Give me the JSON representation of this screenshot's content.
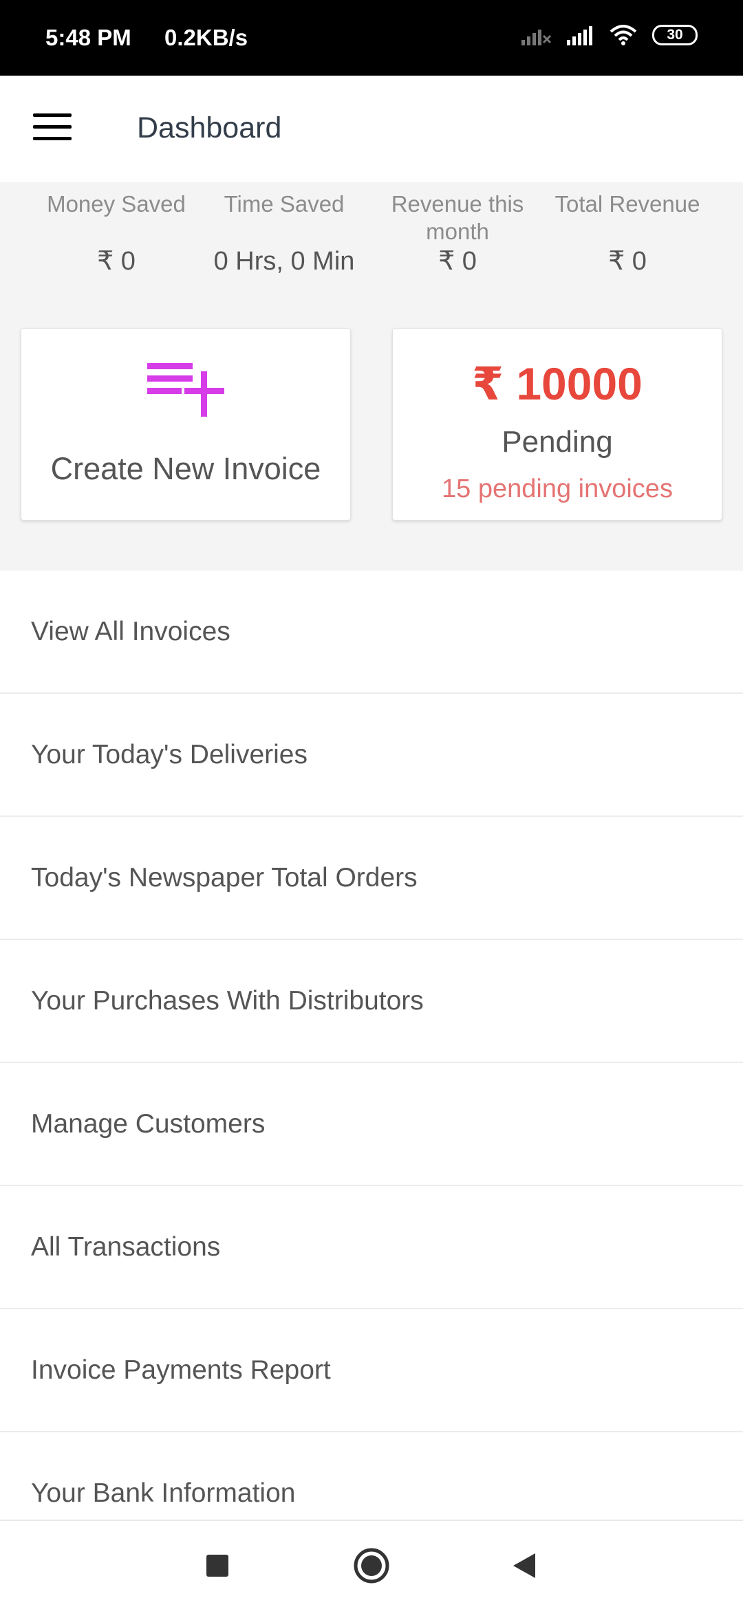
{
  "status_bar": {
    "time": "5:48 PM",
    "speed": "0.2KB/s",
    "battery": "30"
  },
  "app_bar": {
    "title": "Dashboard",
    "menu_icon": "hamburger-menu-icon"
  },
  "stats": [
    {
      "label": "Money Saved",
      "value": "₹ 0"
    },
    {
      "label": "Time Saved",
      "value": "0 Hrs, 0 Min"
    },
    {
      "label": "Revenue this month",
      "value": "₹ 0"
    },
    {
      "label": "Total Revenue",
      "value": "₹ 0"
    }
  ],
  "create_card": {
    "label": "Create New Invoice",
    "icon": "playlist-add-icon",
    "icon_color": "#d63ce8"
  },
  "pending_card": {
    "amount": "₹ 10000",
    "label": "Pending",
    "subtext": "15 pending invoices",
    "amount_color": "#e8473c"
  },
  "menu_items": [
    "View All Invoices",
    "Your Today's Deliveries",
    "Today's Newspaper Total Orders",
    "Your Purchases With Distributors",
    "Manage Customers",
    "All Transactions",
    "Invoice Payments Report",
    "Your Bank Information"
  ],
  "nav": {
    "recents_icon": "square-recents-icon",
    "home_icon": "circle-home-icon",
    "back_icon": "triangle-back-icon"
  }
}
